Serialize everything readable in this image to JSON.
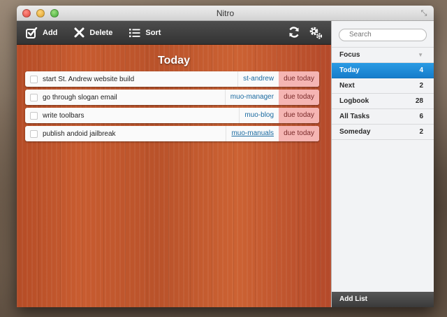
{
  "window": {
    "title": "Nitro"
  },
  "toolbar": {
    "add_label": "Add",
    "delete_label": "Delete",
    "sort_label": "Sort"
  },
  "main": {
    "heading": "Today",
    "tasks": [
      {
        "name": "start St. Andrew website build",
        "tag": "st-andrew",
        "due": "due today"
      },
      {
        "name": "go through slogan email",
        "tag": "muo-manager",
        "due": "due today"
      },
      {
        "name": "write toolbars",
        "tag": "muo-blog",
        "due": "due today"
      },
      {
        "name": "publish andoid jailbreak",
        "tag": "muo-manuals",
        "due": "due today"
      }
    ]
  },
  "sidebar": {
    "search_placeholder": "Search",
    "items": [
      {
        "label": "Focus",
        "count": ""
      },
      {
        "label": "Today",
        "count": "4"
      },
      {
        "label": "Next",
        "count": "2"
      },
      {
        "label": "Logbook",
        "count": "28"
      },
      {
        "label": "All Tasks",
        "count": "6"
      },
      {
        "label": "Someday",
        "count": "2"
      }
    ],
    "add_list_label": "Add List"
  },
  "colors": {
    "accent": "#1a8ad8",
    "due_badge": "#f5b5b3",
    "tag_text": "#1a6aa0"
  }
}
